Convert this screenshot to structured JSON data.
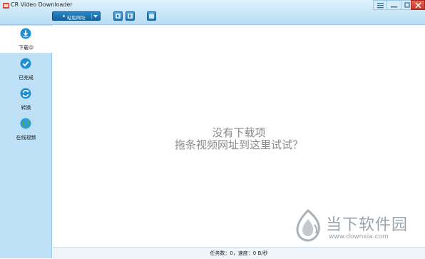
{
  "app": {
    "title": "CR Video Downloader"
  },
  "toolbar": {
    "url_combo_label": "粘贴网址",
    "buttons": [
      {
        "name": "start-download-icon"
      },
      {
        "name": "pause-download-icon"
      },
      {
        "name": "delete-task-icon"
      }
    ]
  },
  "window_controls": [
    "menu-icon",
    "minimize-icon",
    "maximize-icon",
    "close-icon"
  ],
  "sidebar": {
    "items": [
      {
        "label": "下载中",
        "icon": "download-icon",
        "active": true
      },
      {
        "label": "已完成",
        "icon": "check-icon",
        "active": false
      },
      {
        "label": "转换",
        "icon": "convert-icon",
        "active": false
      },
      {
        "label": "在线视频",
        "icon": "globe-icon",
        "active": false
      }
    ]
  },
  "main": {
    "empty_line1": "没有下载项",
    "empty_line2": "拖条视频网址到这里试试？"
  },
  "watermark": {
    "text_cn": "当下软件园",
    "text_en": "www.downxia.com"
  },
  "status": {
    "text": "任务数：0，速度：0 B/秒"
  },
  "colors": {
    "accent": "#1e74b4",
    "sidebar_bg": "#bfe1f7",
    "titlebar_bg": "#c9e6f8",
    "close_red": "#c8372a"
  }
}
